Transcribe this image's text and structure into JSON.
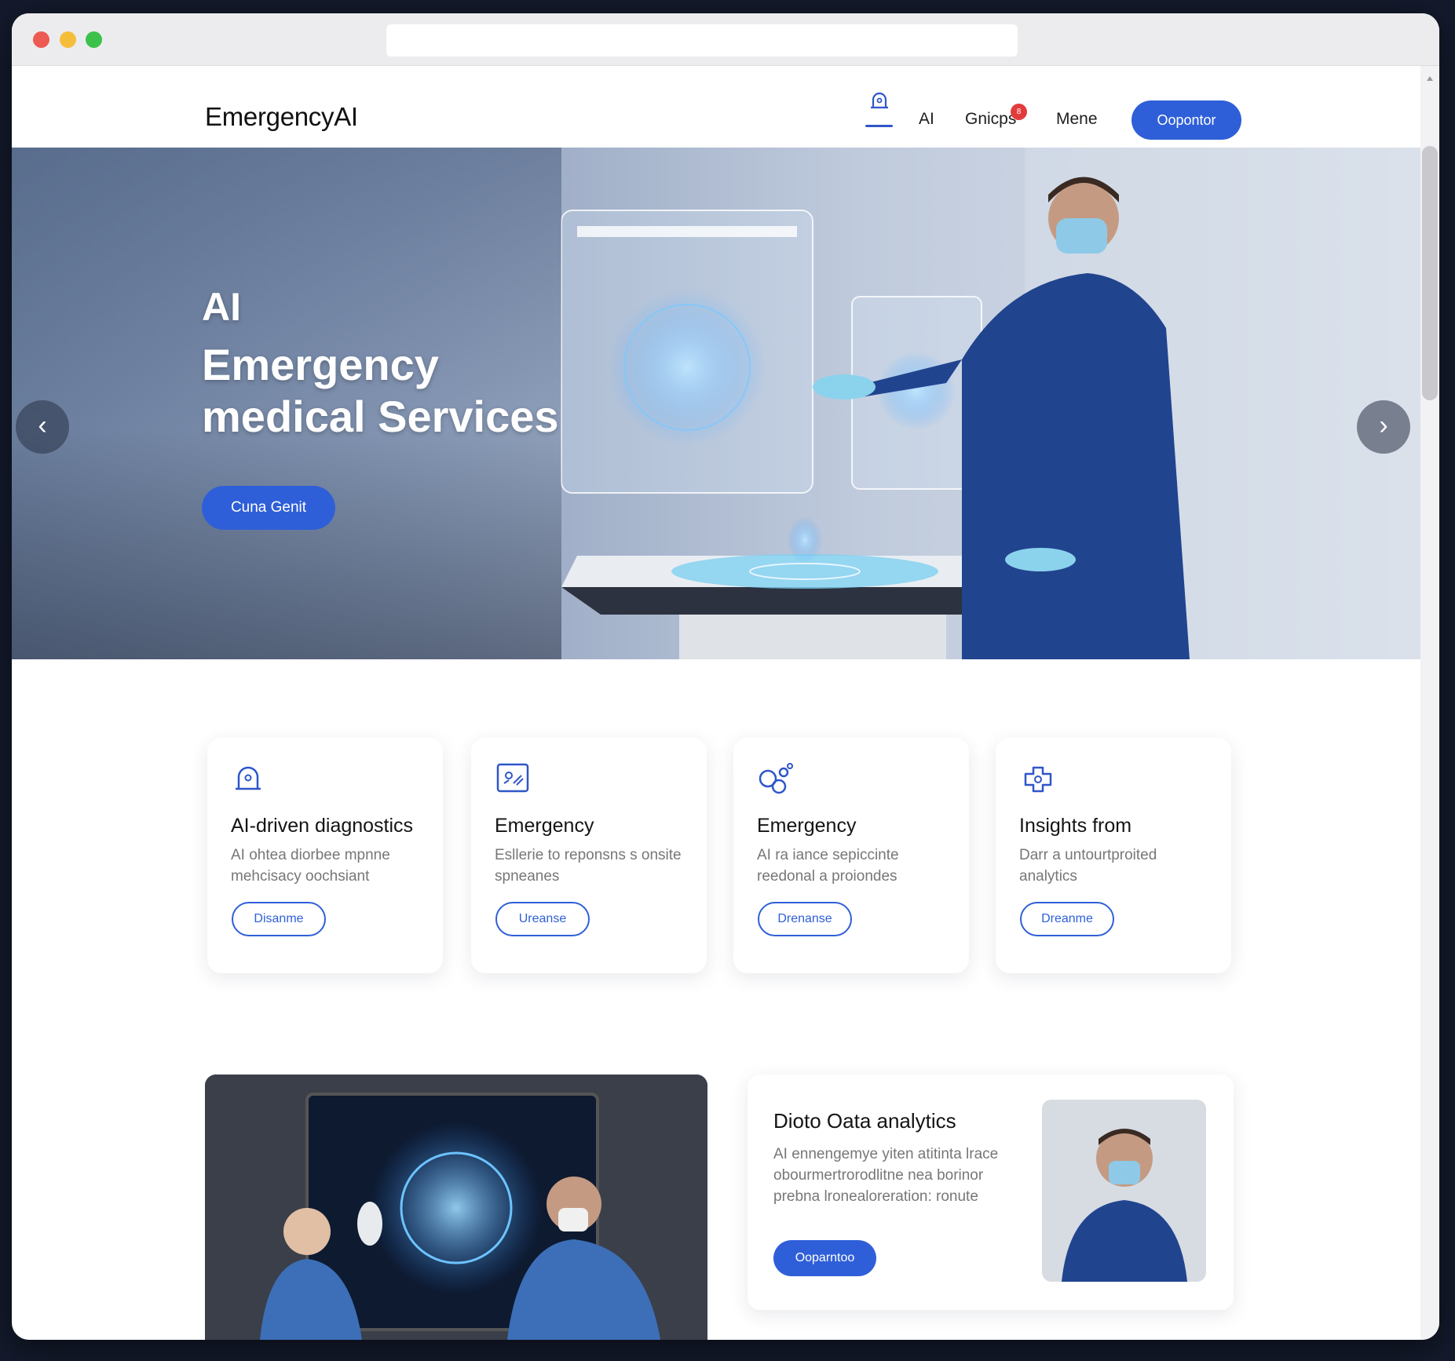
{
  "browser": {
    "url": ""
  },
  "header": {
    "logo": "EmergencyAI",
    "nav": {
      "ai": "AI",
      "groups": "Gnicps",
      "menu": "Mene",
      "badge": "8"
    },
    "cta": "Oopontor"
  },
  "hero": {
    "title_line1": "AI",
    "title_line2": "Emergency medical Services",
    "cta": "Cuna Genit"
  },
  "features": [
    {
      "icon": "ambulance-light-icon",
      "title": "AI-driven diagnostics",
      "desc": "AI ohtea diorbee mpnne mehcisacy oochsiant",
      "button": "Disanme"
    },
    {
      "icon": "diagnostic-screen-icon",
      "title": "Emergency",
      "desc": "Esllerie to reponsns s onsite spneanes",
      "button": "Ureanse"
    },
    {
      "icon": "molecules-icon",
      "title": "Emergency",
      "desc": "AI ra iance sepiccinte reedonal a proiondes",
      "button": "Drenanse"
    },
    {
      "icon": "medical-cross-icon",
      "title": "Insights from",
      "desc": "Darr a untourtproited analytics",
      "button": "Dreanme"
    }
  ],
  "analytics": {
    "title": "Dioto Oata analytics",
    "desc": "AI ennengemye yiten atitinta lrace obourmertrorodlitne nea borinor prebna lronealoreration: ronute",
    "button": "Ooparntoo"
  },
  "colors": {
    "accent": "#2f5fd8",
    "badge": "#e33b3b",
    "dark": "#141a2c"
  }
}
